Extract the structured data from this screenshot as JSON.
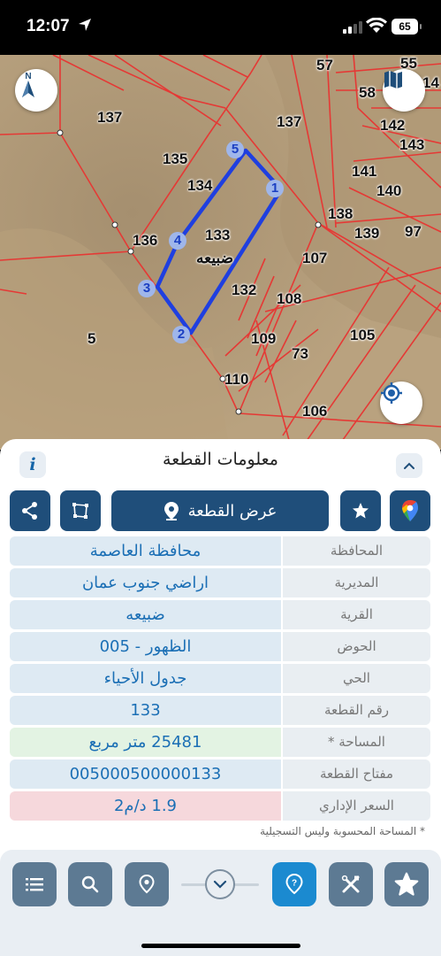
{
  "status_bar": {
    "time": "12:07",
    "battery": "65"
  },
  "map": {
    "labels": [
      "57",
      "55",
      "14",
      "58",
      "137",
      "137",
      "142",
      "143",
      "135",
      "141",
      "134",
      "140",
      "138",
      "133",
      "136",
      "139",
      "97",
      "ضبيعه",
      "107",
      "132",
      "108",
      "5",
      "105",
      "109",
      "73",
      "110",
      "106"
    ],
    "vertices": [
      "5",
      "1",
      "4",
      "3",
      "2"
    ],
    "colors": {
      "parcel_lines": "#e53935",
      "selected_parcel": "#1f3fe0"
    }
  },
  "sheet": {
    "title": "معلومات القطعة",
    "view_parcel_label": "عرض القطعة",
    "rows": [
      {
        "label": "المحافظة",
        "value": "محافظة العاصمة"
      },
      {
        "label": "المديرية",
        "value": "اراضي جنوب عمان"
      },
      {
        "label": "القرية",
        "value": "ضبيعه"
      },
      {
        "label": "الحوض",
        "value": "الظهور - 005"
      },
      {
        "label": "الحي",
        "value": "جدول الأحياء"
      },
      {
        "label": "رقم القطعة",
        "value": "133"
      },
      {
        "label": "المساحة *",
        "value": "25481  متر مربع"
      },
      {
        "label": "مفتاح القطعة",
        "value": "005000500000133"
      },
      {
        "label": "السعر الإداري",
        "value": "1.9 د/م2"
      }
    ],
    "note": "* المساحة المحسوبة وليس التسجيلية"
  },
  "icons": {
    "accent": "#1f4e7a",
    "active": "#1b8ad0"
  }
}
